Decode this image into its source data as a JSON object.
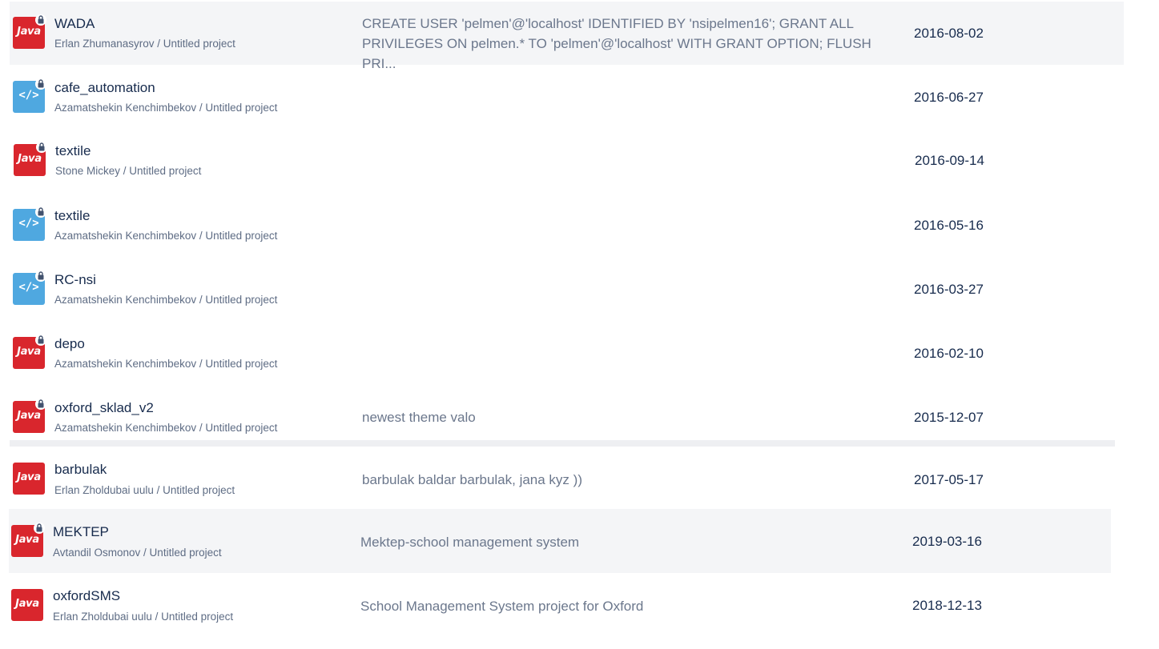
{
  "repos": [
    {
      "name": "WADA",
      "owner": "Erlan Zhumanasyrov / Untitled project",
      "description_line1": "CREATE USER 'pelmen'@'localhost' IDENTIFIED BY 'nsipelmen16'; GRANT ALL",
      "description_line2": "PRIVILEGES ON pelmen.* TO 'pelmen'@'localhost' WITH GRANT OPTION; FLUSH PRI...",
      "date": "2016-08-02",
      "avatar_type": "java",
      "avatar_label": "Java",
      "private": true
    },
    {
      "name": "cafe_automation",
      "owner": "Azamatshekin Kenchimbekov / Untitled project",
      "description_line1": "",
      "description_line2": "",
      "date": "2016-06-27",
      "avatar_type": "code",
      "avatar_label": "</>",
      "private": true
    },
    {
      "name": "textile",
      "owner": "Stone Mickey / Untitled project",
      "description_line1": "",
      "description_line2": "",
      "date": "2016-09-14",
      "avatar_type": "java",
      "avatar_label": "Java",
      "private": true
    },
    {
      "name": "textile",
      "owner": "Azamatshekin Kenchimbekov / Untitled project",
      "description_line1": "",
      "description_line2": "",
      "date": "2016-05-16",
      "avatar_type": "code",
      "avatar_label": "</>",
      "private": true
    },
    {
      "name": "RC-nsi",
      "owner": "Azamatshekin Kenchimbekov / Untitled project",
      "description_line1": "",
      "description_line2": "",
      "date": "2016-03-27",
      "avatar_type": "code",
      "avatar_label": "</>",
      "private": true
    },
    {
      "name": "depo",
      "owner": "Azamatshekin Kenchimbekov / Untitled project",
      "description_line1": "",
      "description_line2": "",
      "date": "2016-02-10",
      "avatar_type": "java",
      "avatar_label": "Java",
      "private": true
    },
    {
      "name": "oxford_sklad_v2",
      "owner": "Azamatshekin Kenchimbekov / Untitled project",
      "description_line1": "newest theme valo",
      "description_line2": "",
      "date": "2015-12-07",
      "avatar_type": "java",
      "avatar_label": "Java",
      "private": true
    },
    {
      "name": "barbulak",
      "owner": "Erlan Zholdubai uulu / Untitled project",
      "description_line1": "barbulak baldar barbulak, jana kyz ))",
      "description_line2": "",
      "date": "2017-05-17",
      "avatar_type": "java",
      "avatar_label": "Java",
      "private": false
    },
    {
      "name": "MEKTEP",
      "owner": "Avtandil Osmonov / Untitled project",
      "description_line1": "Mektep-school management system",
      "description_line2": "",
      "date": "2019-03-16",
      "avatar_type": "java",
      "avatar_label": "Java",
      "private": true
    },
    {
      "name": "oxfordSMS",
      "owner": "Erlan Zholdubai uulu / Untitled project",
      "description_line1": "School Management System project for Oxford",
      "description_line2": "",
      "date": "2018-12-13",
      "avatar_type": "java",
      "avatar_label": "Java",
      "private": false
    }
  ],
  "icons": {
    "java": "java-icon",
    "code": "code-icon",
    "lock": "lock-icon"
  },
  "colors": {
    "java_avatar": "#d9262d",
    "code_avatar": "#4fa8e0",
    "row_highlight": "#f4f5f7"
  }
}
